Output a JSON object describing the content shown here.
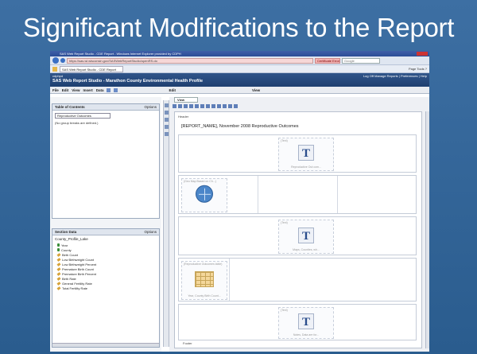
{
  "slide": {
    "title": "Significant Modifications to the Report"
  },
  "browser": {
    "window_title": "SAS Web Report Studio - CDE Report - Windows Internet Explorer provided by CDPH",
    "url": "https://sas.wi.wisconsin.gov/SASWebReportStudio/openRS.do",
    "certificate_label": "Certificate Error",
    "search_placeholder": "Google",
    "tab_label": "SAS Web Report Studio - CDE Report",
    "tab_tools": "Page  Tools  ?"
  },
  "app": {
    "company": "cdphpd",
    "title": "SAS Web Report Studio  -  Marathon County Environmental Health Profile",
    "header_links": "Log Off  Manage Reports  |  Preferences  |  Help"
  },
  "menubar": {
    "file": "File",
    "edit": "Edit",
    "view": "View",
    "insert": "Insert",
    "data": "Data",
    "edit_tab": "Edit",
    "view_tab": "View"
  },
  "toc": {
    "title": "Table of Contents",
    "options": "Options",
    "selected": "Reproductive Outcomes",
    "note": "(No group breaks are defined.)"
  },
  "section_data": {
    "title": "Section Data",
    "options": "Options",
    "source": "County_Profile_Lake",
    "items": [
      {
        "label": "Year",
        "kind": "category"
      },
      {
        "label": "County",
        "kind": "category"
      },
      {
        "label": "Birth Count",
        "kind": "measure"
      },
      {
        "label": "Low Birthweight Count",
        "kind": "measure"
      },
      {
        "label": "Low Birthweight Percent",
        "kind": "measure"
      },
      {
        "label": "Premature Birth Count",
        "kind": "measure"
      },
      {
        "label": "Premature Birth Percent",
        "kind": "measure"
      },
      {
        "label": "Birth Rate",
        "kind": "measure"
      },
      {
        "label": "General Fertility Rate",
        "kind": "measure"
      },
      {
        "label": "Total Fertility Rate",
        "kind": "measure"
      }
    ]
  },
  "report": {
    "view_tab": "View",
    "header_label": "Header",
    "title": "[REPORT_NAME], November 2008 Reproductive Outcomes",
    "footer_label": "Footer",
    "cells": {
      "text1_cap": "(Text)",
      "text1_sub": "Reproductive Out com...",
      "map_cap": "(Geo Map Based on Ch...)",
      "text2_cap": "(Text)",
      "text2_sub": "Maps, Counties, wh...",
      "table_cap": "(Reproductive Outcomes table)",
      "table_sub": "Year, County Birth Count...",
      "text3_cap": "(Text)",
      "text3_sub": "Notes, Data are for..."
    }
  }
}
